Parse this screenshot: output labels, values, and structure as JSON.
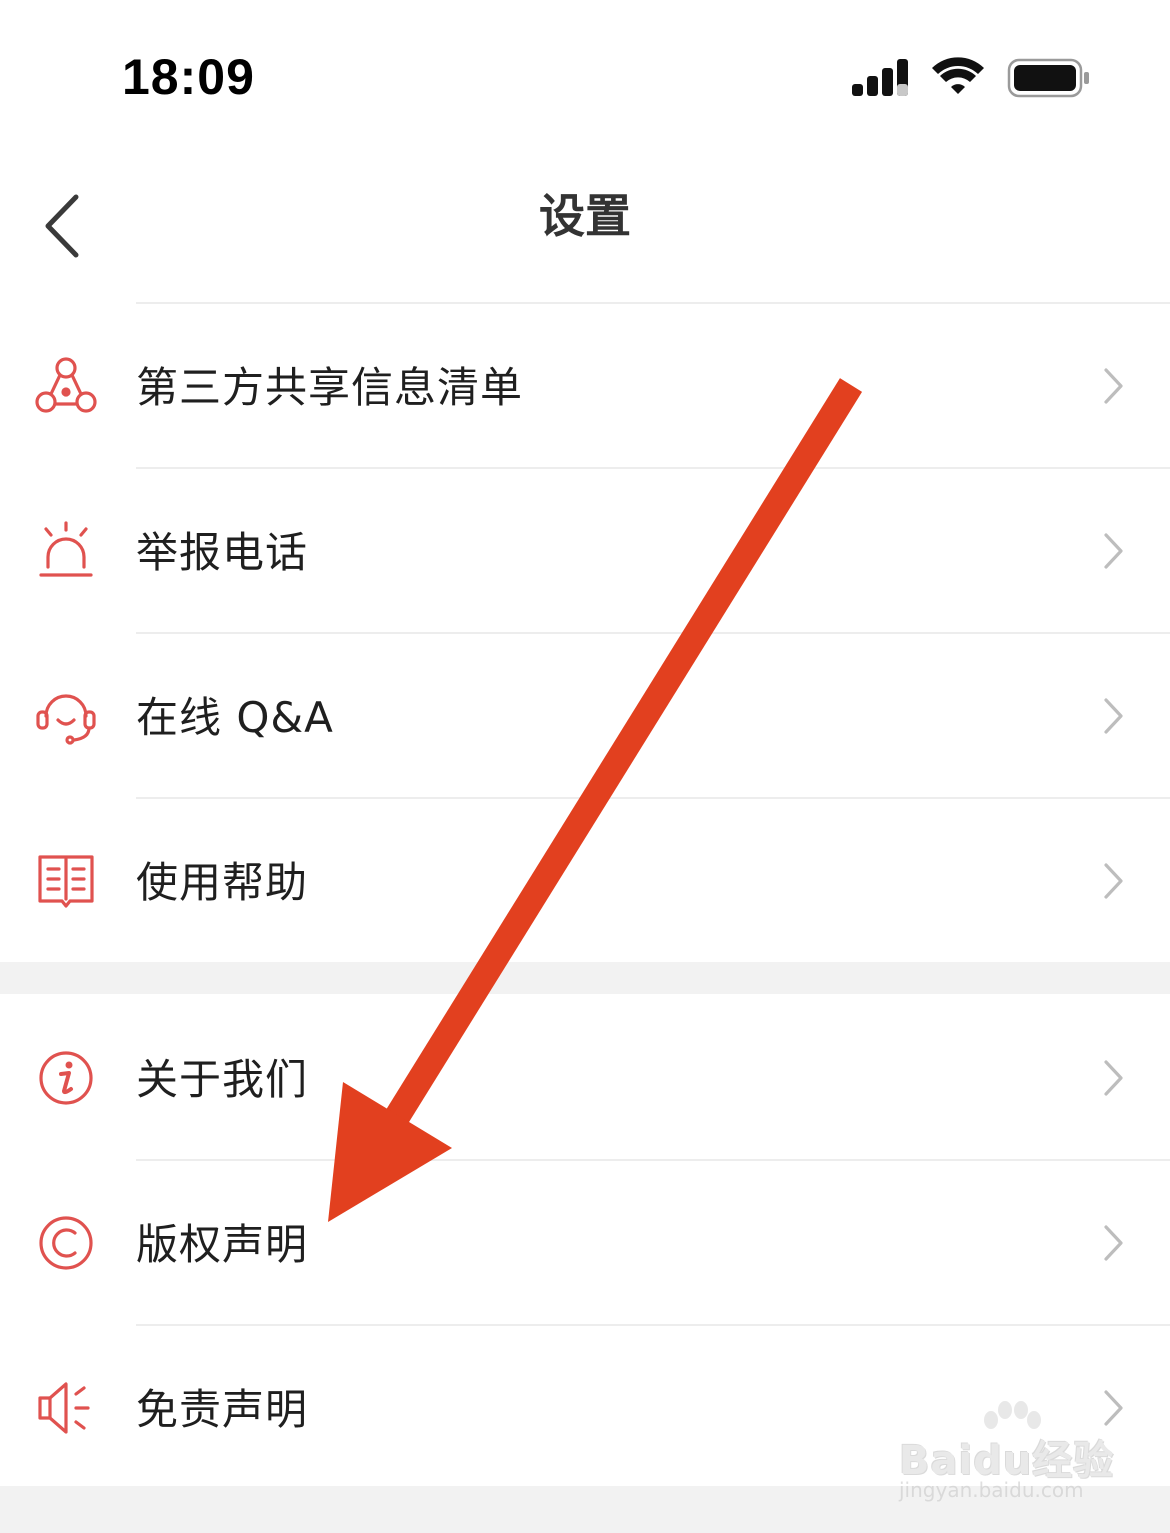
{
  "status_bar": {
    "time": "18:09"
  },
  "header": {
    "title": "设置"
  },
  "groups": [
    {
      "items": [
        {
          "label": "第三方共享信息清单",
          "icon": "network-share-icon"
        },
        {
          "label": "举报电话",
          "icon": "alarm-icon"
        },
        {
          "label": "在线 Q&A",
          "icon": "headset-icon"
        },
        {
          "label": "使用帮助",
          "icon": "book-icon"
        }
      ]
    },
    {
      "items": [
        {
          "label": "关于我们",
          "icon": "info-icon"
        },
        {
          "label": "版权声明",
          "icon": "copyright-icon"
        },
        {
          "label": "免责声明",
          "icon": "speaker-icon"
        }
      ]
    }
  ],
  "watermark": {
    "brand": "Baidu经验",
    "url": "jingyan.baidu.com"
  },
  "colors": {
    "icon_red": "#e0524f",
    "annotation_arrow": "#e2401f",
    "chevron": "#bdbdbd"
  }
}
